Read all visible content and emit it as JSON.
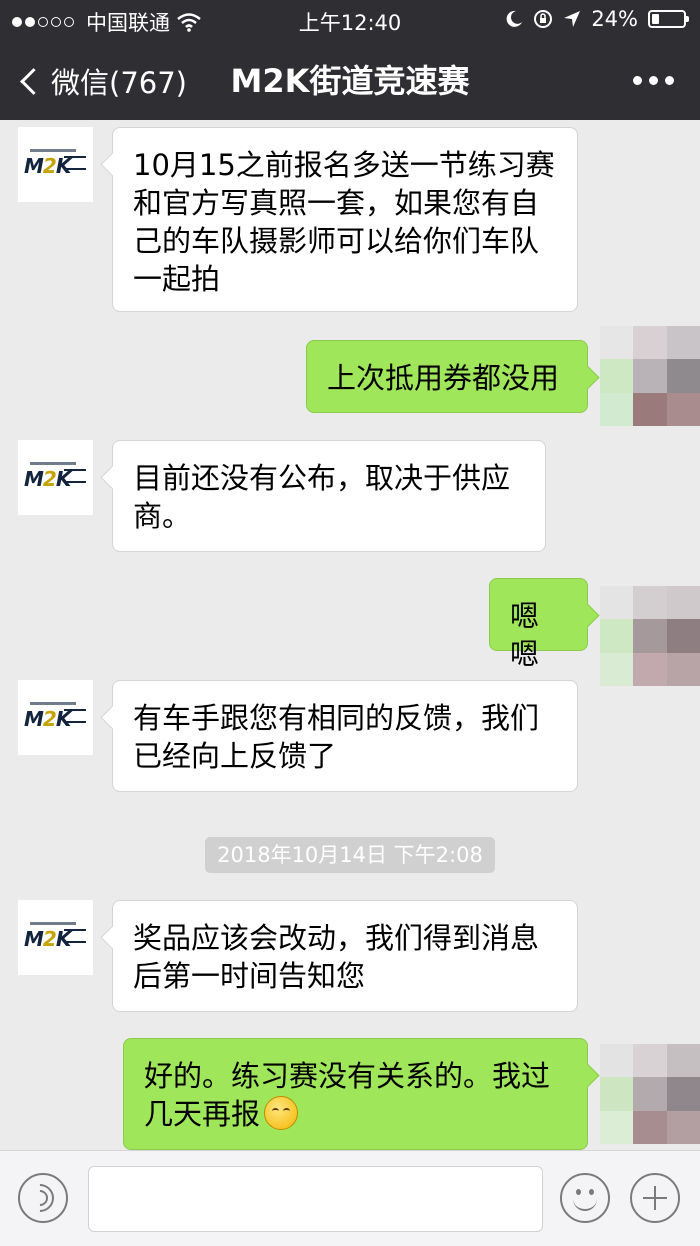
{
  "status_bar": {
    "carrier": "中国联通",
    "time": "上午12:40",
    "battery": "24%",
    "battery_level": 0.24
  },
  "nav": {
    "back_label": "微信(767)",
    "title": "M2K街道竞速赛"
  },
  "avatar_logo": {
    "mark": "M2K",
    "accent_letter": "2"
  },
  "messages": [
    {
      "dir": "in",
      "text": "10月15之前报名多送一节练习赛和官方写真照一套，如果您有自己的车队摄影师可以给你们车队一起拍"
    },
    {
      "dir": "out",
      "text": "上次抵用券都没用"
    },
    {
      "dir": "in",
      "text": "目前还没有公布，取决于供应商。"
    },
    {
      "dir": "out",
      "text": "嗯嗯"
    },
    {
      "dir": "in",
      "text": "有车手跟您有相同的反馈，我们已经向上反馈了"
    },
    {
      "dir": "in",
      "text": "奖品应该会改动，我们得到消息后第一时间告知您"
    },
    {
      "dir": "out",
      "text": "好的。练习赛没有关系的。我过几天再报",
      "emoji": "smirk-emoji"
    }
  ],
  "timestamp": "2018年10月14日 下午2:08",
  "colors": {
    "nav_bg": "#2e2e33",
    "chat_bg": "#ebebeb",
    "outgoing_bubble": "#9fe65a",
    "incoming_bubble": "#ffffff"
  }
}
